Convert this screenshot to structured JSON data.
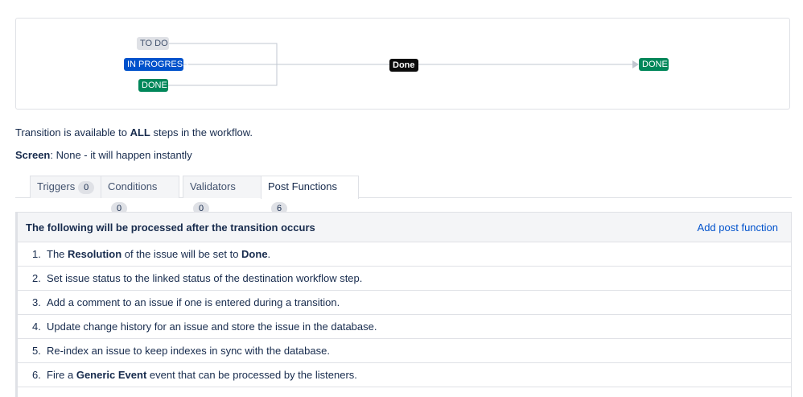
{
  "diagram": {
    "source_steps": [
      "TO DO",
      "IN PROGRESS",
      "DONE"
    ],
    "transition": "Done",
    "target_step": "DONE",
    "colors": {
      "todo": "#dfe1e6",
      "in_progress": "#0052cc",
      "done": "#00875a",
      "transition": "#0b0b0b"
    }
  },
  "availability": {
    "prefix": "Transition is available to ",
    "bold": "ALL",
    "suffix": " steps in the workflow."
  },
  "screen": {
    "label": "Screen",
    "value": ": None - it will happen instantly"
  },
  "tabs": [
    {
      "label": "Triggers",
      "count": "0",
      "active": false
    },
    {
      "label": "Conditions",
      "count": "0",
      "active": false
    },
    {
      "label": "Validators",
      "count": "0",
      "active": false
    },
    {
      "label": "Post Functions",
      "count": "6",
      "active": true
    }
  ],
  "post_functions": {
    "header": "The following will be processed after the transition occurs",
    "add_label": "Add post function",
    "items": [
      {
        "num": "1.",
        "p1": "The ",
        "b1": "Resolution",
        "p2": " of the issue will be set to ",
        "b2": "Done",
        "p3": "."
      },
      {
        "num": "2.",
        "text": "Set issue status to the linked status of the destination workflow step."
      },
      {
        "num": "3.",
        "text": "Add a comment to an issue if one is entered during a transition."
      },
      {
        "num": "4.",
        "text": "Update change history for an issue and store the issue in the database."
      },
      {
        "num": "5.",
        "text": "Re-index an issue to keep indexes in sync with the database."
      },
      {
        "num": "6.",
        "p1": "Fire a ",
        "b1": "Generic Event",
        "p2": " event that can be processed by the listeners."
      }
    ]
  }
}
